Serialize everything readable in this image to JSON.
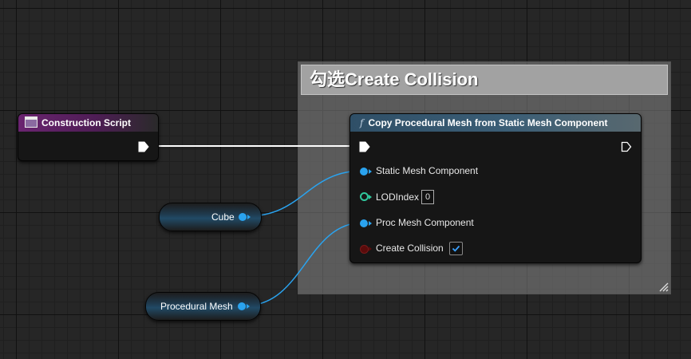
{
  "comment_box": {
    "title": "勾选Create Collision"
  },
  "construction_node": {
    "title": "Construction Script"
  },
  "function_node": {
    "title": "Copy Procedural Mesh from Static Mesh Component",
    "pins": {
      "static_mesh_component": "Static Mesh Component",
      "lod_index": "LODIndex",
      "proc_mesh_component": "Proc Mesh Component",
      "create_collision": "Create Collision"
    },
    "lod_index_value": "0",
    "create_collision_checked": true
  },
  "variables": {
    "cube": "Cube",
    "procedural_mesh": "Procedural Mesh"
  },
  "colors": {
    "object_pin": "#2aa3ef",
    "int_pin": "#30c79c",
    "bool_pin": "#5a0b0b",
    "construction_header": "#6a2470",
    "function_header": "#2f4f67"
  }
}
